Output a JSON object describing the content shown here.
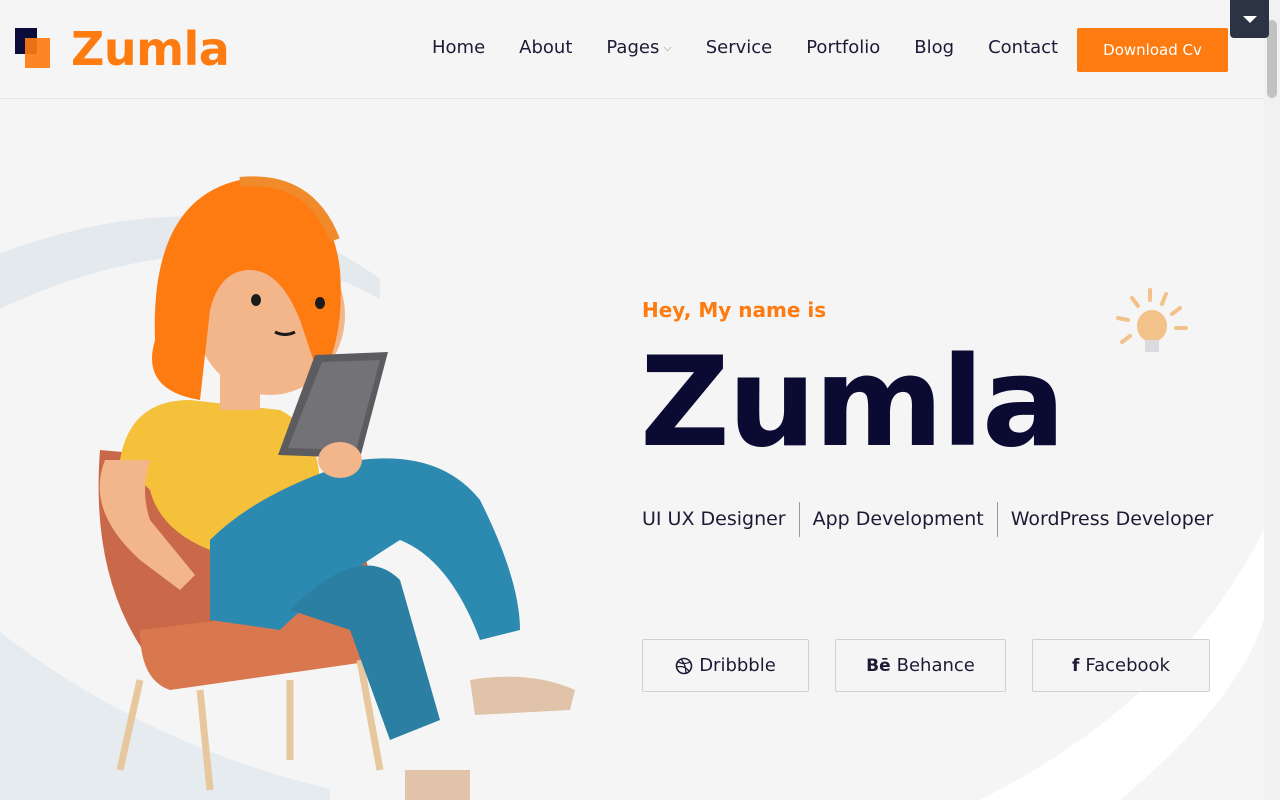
{
  "brand": {
    "name": "Zumla"
  },
  "nav": {
    "items": [
      {
        "label": "Home"
      },
      {
        "label": "About"
      },
      {
        "label": "Pages",
        "has_dropdown": true
      },
      {
        "label": "Service"
      },
      {
        "label": "Portfolio"
      },
      {
        "label": "Blog"
      },
      {
        "label": "Contact"
      }
    ],
    "cta_label": "Download Cv"
  },
  "hero": {
    "greeting": "Hey, My name is",
    "name": "Zumla",
    "roles": [
      "UI UX Designer",
      "App Development",
      "WordPress Developer"
    ]
  },
  "socials": [
    {
      "label": "Dribbble",
      "icon": "dribbble-icon",
      "glyph": ""
    },
    {
      "label": "Behance",
      "icon": "behance-icon",
      "glyph": "Bē"
    },
    {
      "label": "Facebook",
      "icon": "facebook-icon",
      "glyph": "f"
    }
  ],
  "colors": {
    "accent": "#fd7b10",
    "heading": "#0a0a33",
    "background": "#f5f5f5"
  }
}
